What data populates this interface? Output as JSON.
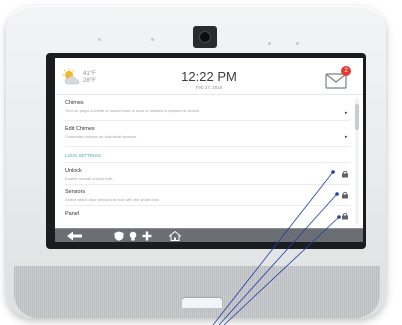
{
  "clock": {
    "time": "12:22 PM",
    "date": "Feb 27, 2018"
  },
  "weather": {
    "icon": "partly-cloudy-icon",
    "high": "41°F",
    "low": "28°F"
  },
  "notifications": {
    "icon": "envelope-icon",
    "badge": "2"
  },
  "list": {
    "items": [
      {
        "title": "Chimes",
        "subtitle": "Turn on plays a chime or sound when a door or window is opened or closed"
      },
      {
        "title": "Edit Chimes",
        "subtitle": "Customize chimes for individual sensors"
      }
    ],
    "section_title": "LOCK SETTINGS",
    "lock_items": [
      {
        "title": "Unlock",
        "subtitle": "Enable remote unlock with..."
      },
      {
        "title": "Sensors",
        "subtitle": "Select which door sensors to lock with the smart lock"
      },
      {
        "title": "Panel",
        "subtitle": ""
      }
    ]
  },
  "bottom_bar": {
    "icons": [
      "back-arrow-icon",
      "shield-icon",
      "lightbulb-icon",
      "home-icon"
    ]
  },
  "colors": {
    "accent": "#4aa9a0",
    "badge": "#e23a2e",
    "callout_line": "#1f3fa8",
    "bezel": "#e9eaec"
  }
}
